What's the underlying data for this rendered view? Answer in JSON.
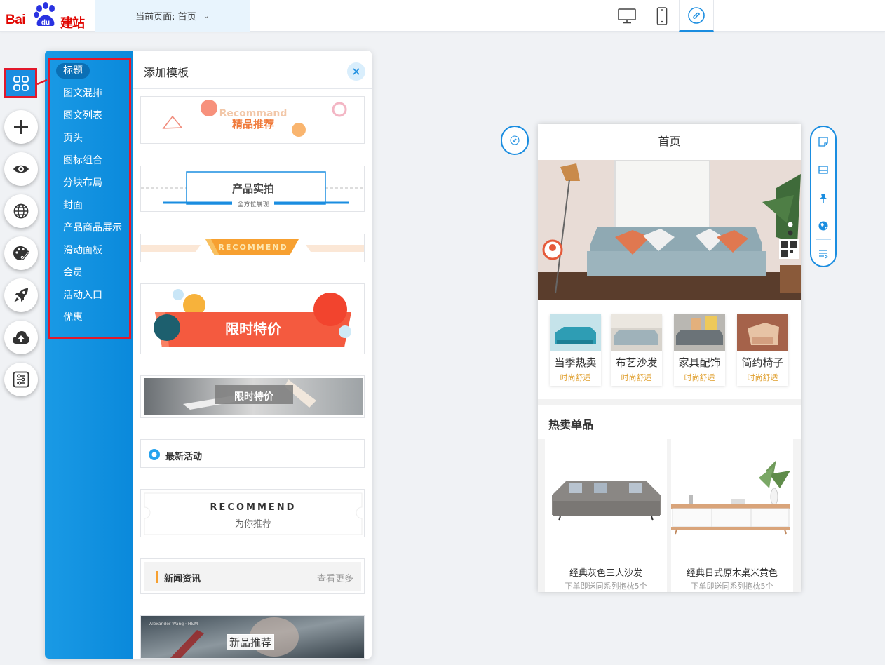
{
  "header": {
    "logo_text_1": "Bai",
    "logo_text_2": "du",
    "logo_text_3": "建站",
    "page_selector_label": "当前页面: 首页",
    "devices": [
      "desktop-icon",
      "mobile-icon",
      "mini-program-icon"
    ],
    "active_device": "mini-program-icon"
  },
  "rail": {
    "items": [
      "grid-icon",
      "plus-icon",
      "eye-icon",
      "globe-icon",
      "palette-icon",
      "rocket-icon",
      "cloud-upload-icon",
      "sliders-icon"
    ]
  },
  "categories": {
    "active": "标题",
    "items": [
      "标题",
      "图文混排",
      "图文列表",
      "页头",
      "图标组合",
      "分块布局",
      "封面",
      "产品商品展示",
      "滑动面板",
      "会员",
      "活动入口",
      "优惠"
    ]
  },
  "templates": {
    "title": "添加模板",
    "items": [
      {
        "main": "精品推荐",
        "sub": "Recommand"
      },
      {
        "main": "产品实拍",
        "sub": "全方位展现"
      },
      {
        "main": "RECOMMEND",
        "sub": ""
      },
      {
        "main": "限时特价",
        "sub": ""
      },
      {
        "main": "限时特价",
        "sub": ""
      },
      {
        "main": "最新活动",
        "sub": ""
      },
      {
        "main": "RECOMMEND",
        "sub": "为你推荐"
      },
      {
        "main": "新闻资讯",
        "sub": "查看更多"
      },
      {
        "main": "新品推荐",
        "sub": "Alexander Wang · H&M"
      }
    ]
  },
  "phone": {
    "title": "首页",
    "categories": [
      {
        "label": "当季热卖",
        "sub": "时尚舒适"
      },
      {
        "label": "布艺沙发",
        "sub": "时尚舒适"
      },
      {
        "label": "家具配饰",
        "sub": "时尚舒适"
      },
      {
        "label": "简约椅子",
        "sub": "时尚舒适"
      }
    ],
    "hot_title": "热卖单品",
    "products": [
      {
        "name": "经典灰色三人沙发",
        "sub": "下单即送同系列抱枕5个"
      },
      {
        "name": "经典日式原木桌米黄色",
        "sub": "下单即送同系列抱枕5个"
      }
    ]
  },
  "colors": {
    "accent": "#1a8de0",
    "highlight_red": "#e2182b",
    "brand_red": "#e10602",
    "sub_orange": "#e0a030"
  }
}
